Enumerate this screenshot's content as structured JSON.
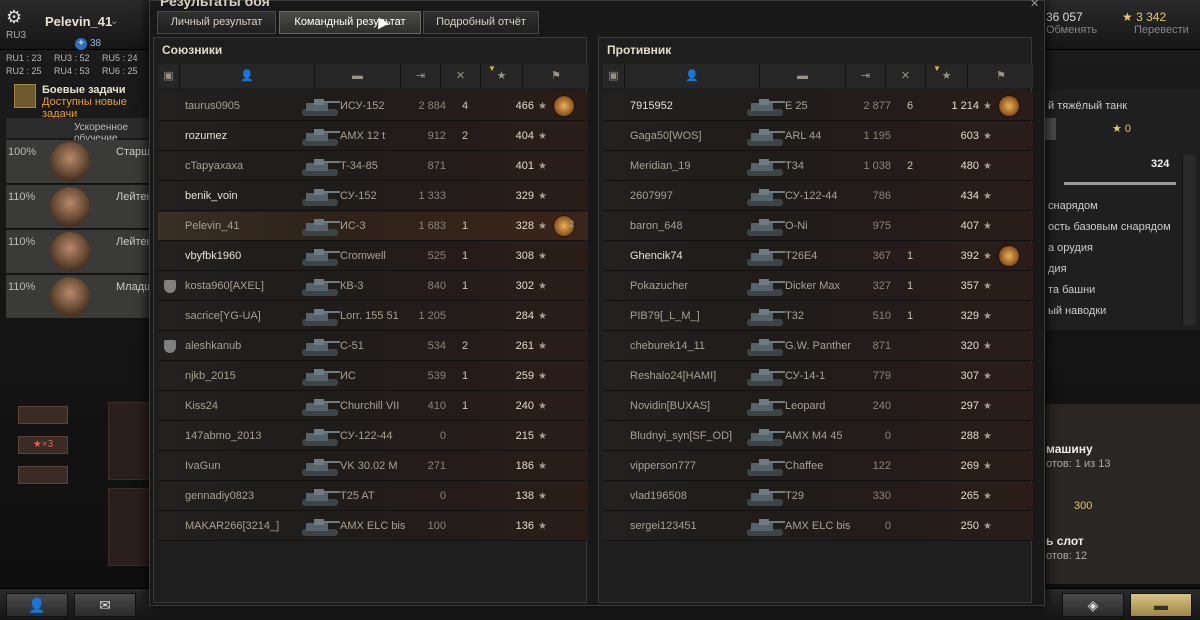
{
  "hangar": {
    "player_name": "Pelevin_41",
    "server": "RU3",
    "online_count": "38",
    "clusters": [
      {
        "name": "RU1",
        "value": "23"
      },
      {
        "name": "RU3",
        "value": "52"
      },
      {
        "name": "RU5",
        "value": "24"
      },
      {
        "name": "RU2",
        "value": "25"
      },
      {
        "name": "RU4",
        "value": "53"
      },
      {
        "name": "RU6",
        "value": "25"
      }
    ],
    "credits": "36 057",
    "exchange_label": "Обменять",
    "gold": "3 342",
    "transfer_label": "Перевести",
    "missions_title": "Боевые задачи",
    "missions_sub": "Доступны новые задачи",
    "crew_training_label": "Ускоренное обучение",
    "crew": [
      {
        "pct": "100%",
        "rank": "Старший"
      },
      {
        "pct": "110%",
        "rank": "Лейтенант"
      },
      {
        "pct": "110%",
        "rank": "Лейтенант"
      },
      {
        "pct": "110%",
        "rank": "Младший"
      }
    ],
    "bonus_label": "×3",
    "right_panel": {
      "line1": "й тяжёлый танк",
      "zero": "0",
      "slider_value": "324",
      "lines": [
        "снарядом",
        "ость базовым снарядом",
        "а орудия",
        "дия",
        "та башни",
        "ый наводки"
      ],
      "buy_tank": "машину",
      "slots_line": "отов: 1 из 13",
      "price": "300",
      "slot": "ь слот",
      "slots_count": "отов: 12"
    }
  },
  "dialog": {
    "title": "Результаты боя",
    "tabs": [
      "Личный результат",
      "Командный результат",
      "Подробный отчёт"
    ],
    "active_tab": 1,
    "allies_title": "Союзники",
    "enemies_title": "Противник",
    "allies": [
      {
        "name": "taurus0905",
        "tank": "ИСУ-152",
        "damage": "2 884",
        "kills": "4",
        "xp": "466",
        "medal": true,
        "medal_count": "",
        "squad": false,
        "self": false,
        "bright": false
      },
      {
        "name": "rozumez",
        "tank": "AMX 12 t",
        "damage": "912",
        "kills": "2",
        "xp": "404",
        "medal": false,
        "medal_count": "",
        "squad": false,
        "self": false,
        "bright": true
      },
      {
        "name": "cTapyaxaxa",
        "tank": "T-34-85",
        "damage": "871",
        "kills": "",
        "xp": "401",
        "medal": false,
        "medal_count": "",
        "squad": false,
        "self": false,
        "bright": false
      },
      {
        "name": "benik_voin",
        "tank": "СУ-152",
        "damage": "1 333",
        "kills": "",
        "xp": "329",
        "medal": false,
        "medal_count": "",
        "squad": false,
        "self": false,
        "bright": true
      },
      {
        "name": "Pelevin_41",
        "tank": "ИС-3",
        "damage": "1 683",
        "kills": "1",
        "xp": "328",
        "medal": true,
        "medal_count": "2",
        "squad": false,
        "self": true,
        "bright": false
      },
      {
        "name": "vbyfbk1960",
        "tank": "Cromwell",
        "damage": "525",
        "kills": "1",
        "xp": "308",
        "medal": false,
        "medal_count": "",
        "squad": false,
        "self": false,
        "bright": true
      },
      {
        "name": "kosta960[AXEL]",
        "tank": "КВ-3",
        "damage": "840",
        "kills": "1",
        "xp": "302",
        "medal": false,
        "medal_count": "",
        "squad": true,
        "self": false,
        "bright": false
      },
      {
        "name": "sacrice[YG-UA]",
        "tank": "Lorr. 155 51",
        "damage": "1 205",
        "kills": "",
        "xp": "284",
        "medal": false,
        "medal_count": "",
        "squad": false,
        "self": false,
        "bright": false
      },
      {
        "name": "aleshkanub",
        "tank": "С-51",
        "damage": "534",
        "kills": "2",
        "xp": "261",
        "medal": false,
        "medal_count": "",
        "squad": true,
        "self": false,
        "bright": false
      },
      {
        "name": "njkb_2015",
        "tank": "ИС",
        "damage": "539",
        "kills": "1",
        "xp": "259",
        "medal": false,
        "medal_count": "",
        "squad": false,
        "self": false,
        "bright": false
      },
      {
        "name": "Kiss24",
        "tank": "Churchill VII",
        "damage": "410",
        "kills": "1",
        "xp": "240",
        "medal": false,
        "medal_count": "",
        "squad": false,
        "self": false,
        "bright": false
      },
      {
        "name": "147abmo_2013",
        "tank": "СУ-122-44",
        "damage": "0",
        "kills": "",
        "xp": "215",
        "medal": false,
        "medal_count": "",
        "squad": false,
        "self": false,
        "bright": false
      },
      {
        "name": "IvaGun",
        "tank": "VK 30.02 M",
        "damage": "271",
        "kills": "",
        "xp": "186",
        "medal": false,
        "medal_count": "",
        "squad": false,
        "self": false,
        "bright": false
      },
      {
        "name": "gennadiy0823",
        "tank": "T25 AT",
        "damage": "0",
        "kills": "",
        "xp": "138",
        "medal": false,
        "medal_count": "",
        "squad": false,
        "self": false,
        "bright": false
      },
      {
        "name": "MAKAR266[3214_]",
        "tank": "AMX ELC bis",
        "damage": "100",
        "kills": "",
        "xp": "136",
        "medal": false,
        "medal_count": "",
        "squad": false,
        "self": false,
        "bright": false
      }
    ],
    "enemies": [
      {
        "name": "7915952",
        "tank": "E 25",
        "damage": "2 877",
        "kills": "6",
        "xp": "1 214",
        "medal": true,
        "medal_count": "",
        "squad": false,
        "self": false,
        "bright": true
      },
      {
        "name": "Gaga50[WOS]",
        "tank": "ARL 44",
        "damage": "1 195",
        "kills": "",
        "xp": "603",
        "medal": false,
        "medal_count": "",
        "squad": false,
        "self": false,
        "bright": false
      },
      {
        "name": "Meridian_19",
        "tank": "T34",
        "damage": "1 038",
        "kills": "2",
        "xp": "480",
        "medal": false,
        "medal_count": "",
        "squad": false,
        "self": false,
        "bright": false
      },
      {
        "name": "2607997",
        "tank": "СУ-122-44",
        "damage": "786",
        "kills": "",
        "xp": "434",
        "medal": false,
        "medal_count": "",
        "squad": false,
        "self": false,
        "bright": false
      },
      {
        "name": "baron_648",
        "tank": "O-Ni",
        "damage": "975",
        "kills": "",
        "xp": "407",
        "medal": false,
        "medal_count": "",
        "squad": false,
        "self": false,
        "bright": false
      },
      {
        "name": "Ghencik74",
        "tank": "T26E4",
        "damage": "367",
        "kills": "1",
        "xp": "392",
        "medal": true,
        "medal_count": "",
        "squad": false,
        "self": false,
        "bright": true
      },
      {
        "name": "Pokazucher",
        "tank": "Dicker Max",
        "damage": "327",
        "kills": "1",
        "xp": "357",
        "medal": false,
        "medal_count": "",
        "squad": false,
        "self": false,
        "bright": false
      },
      {
        "name": "PIB79[_L_M_]",
        "tank": "T32",
        "damage": "510",
        "kills": "1",
        "xp": "329",
        "medal": false,
        "medal_count": "",
        "squad": false,
        "self": false,
        "bright": false
      },
      {
        "name": "cheburek14_11",
        "tank": "G.W. Panther",
        "damage": "871",
        "kills": "",
        "xp": "320",
        "medal": false,
        "medal_count": "",
        "squad": false,
        "self": false,
        "bright": false
      },
      {
        "name": "Reshalo24[HAMI]",
        "tank": "СУ-14-1",
        "damage": "779",
        "kills": "",
        "xp": "307",
        "medal": false,
        "medal_count": "",
        "squad": false,
        "self": false,
        "bright": false
      },
      {
        "name": "Novidin[BUXAS]",
        "tank": "Leopard",
        "damage": "240",
        "kills": "",
        "xp": "297",
        "medal": false,
        "medal_count": "",
        "squad": false,
        "self": false,
        "bright": false
      },
      {
        "name": "Bludnyi_syn[SF_OD]",
        "tank": "AMX M4 45",
        "damage": "0",
        "kills": "",
        "xp": "288",
        "medal": false,
        "medal_count": "",
        "squad": false,
        "self": false,
        "bright": false
      },
      {
        "name": "vipperson777",
        "tank": "Chaffee",
        "damage": "122",
        "kills": "",
        "xp": "269",
        "medal": false,
        "medal_count": "",
        "squad": false,
        "self": false,
        "bright": false
      },
      {
        "name": "vlad196508",
        "tank": "T29",
        "damage": "330",
        "kills": "",
        "xp": "265",
        "medal": false,
        "medal_count": "",
        "squad": false,
        "self": false,
        "bright": false
      },
      {
        "name": "sergei123451",
        "tank": "AMX ELC bis",
        "damage": "0",
        "kills": "",
        "xp": "250",
        "medal": false,
        "medal_count": "",
        "squad": false,
        "self": false,
        "bright": false
      }
    ],
    "star_glyph": "★"
  },
  "colors": {
    "accent_gold": "#e6c66a",
    "orange_text": "#e7a236",
    "medal": "#e8b25a"
  }
}
